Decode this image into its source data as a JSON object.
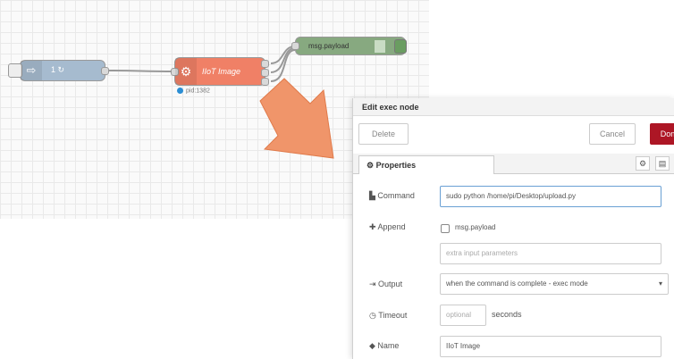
{
  "flow": {
    "inject_node": {
      "label": "1 ↻"
    },
    "exec_node": {
      "label": "IIoT Image",
      "status": "pid:1382"
    },
    "debug_node": {
      "label": "msg.payload"
    }
  },
  "panel": {
    "title": "Edit exec node",
    "buttons": {
      "delete": "Delete",
      "cancel": "Cancel",
      "done": "Don"
    },
    "tab_properties": "Properties",
    "fields": {
      "command_label": "Command",
      "command_value": "sudo python /home/pi/Desktop/upload.py",
      "append_label": "Append",
      "append_checkbox": "msg.payload",
      "extra_placeholder": "extra input parameters",
      "output_label": "Output",
      "output_value": "when the command is complete - exec mode",
      "timeout_label": "Timeout",
      "timeout_placeholder": "optional",
      "timeout_unit": "seconds",
      "name_label": "Name",
      "name_value": "IIoT Image"
    }
  },
  "colors": {
    "inject": "#a6bbcf",
    "exec": "#f08066",
    "debug": "#87a980",
    "arrow": "#f0956a",
    "done": "#ad1625"
  }
}
